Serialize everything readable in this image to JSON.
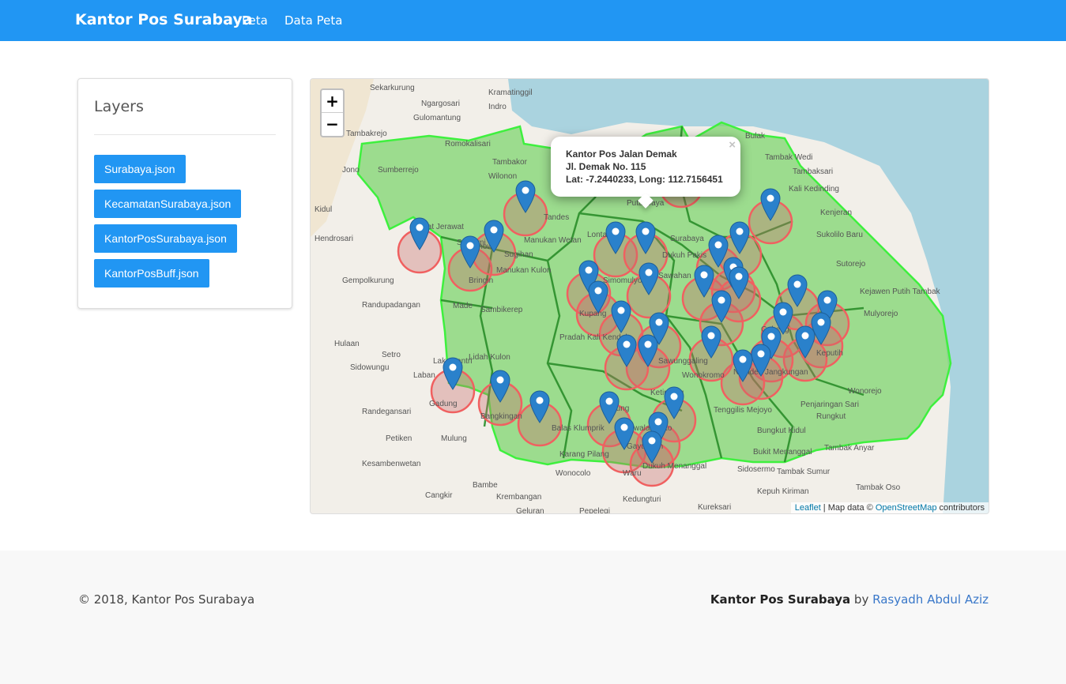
{
  "navbar": {
    "brand": "Kantor Pos Surabaya",
    "links": [
      "Peta",
      "Data Peta"
    ],
    "color": "#2196f3"
  },
  "layers": {
    "title": "Layers",
    "buttons": [
      "Surabaya.json",
      "KecamatanSurabaya.json",
      "KantorPosSurabaya.json",
      "KantorPosBuff.json"
    ]
  },
  "map": {
    "zoom_in": "+",
    "zoom_out": "−",
    "popup": {
      "name": "Kantor Pos Jalan Demak",
      "address": "Jl. Demak No. 115",
      "coords": "Lat: -7.2440233, Long: 112.7156451",
      "close": "×"
    },
    "attribution": {
      "leaflet": "Leaflet",
      "text": " | Map data © ",
      "osm": "OpenStreetMap",
      "suffix": " contributors"
    },
    "place_labels": [
      "Sekarkurung",
      "Kramatinggil",
      "Ngargosari",
      "Indro",
      "Gulomantung",
      "Tambakrejo",
      "Romokalisari",
      "Tambakor",
      "Wilonon",
      "Sumberrejo",
      "Jono",
      "Kidul",
      "Hendrosari",
      "Gempolkurung",
      "Randupadangan",
      "Bringin",
      "Manukan Wetan",
      "Manukan Kulon",
      "Sambikerep",
      "Made",
      "Pradah Kali Kendal",
      "Hulaan",
      "Setro",
      "Sidowungu",
      "Laban",
      "Gadung",
      "Randegansari",
      "Petiken",
      "Mulung",
      "Kesambenwetan",
      "Cangkir",
      "Bambe",
      "Krembangan",
      "Geluran",
      "Pepelegi",
      "Wonocolo",
      "Waru",
      "Kedungturi",
      "Kureksari",
      "Kepuh Kiriman",
      "Tambak Oso",
      "Tambak Sumur",
      "Tambak Anyar",
      "Bukit Menanggal",
      "Bungkut Kidul",
      "Penjaringan Sari",
      "Wonorejo",
      "Kejawen Putih Tambak",
      "Sukolilo Baru",
      "Kenjeran",
      "Bulak",
      "Tambak Wedi",
      "Kali Kedinding",
      "Surabaya",
      "Tandes",
      "Sawahan",
      "Dukuh Pakis",
      "Sutorejo",
      "Keputih",
      "Tenggilis Mejoyo",
      "Nginden Jangkungan",
      "Gayungan",
      "Karang Pilang",
      "Babat Jerawat",
      "Benowo",
      "Sugihan",
      "Simomulyo",
      "Sawunggaling",
      "Wonokromo",
      "Dukuh Menanggal",
      "Sidosermo",
      "Wiyung",
      "Balas Klumprik",
      "Bangkingan",
      "Lakarsantri",
      "Dupak",
      "Tambaksari",
      "Mulyorejo",
      "Gubeng",
      "Rungkut",
      "Siwalankerto",
      "Ketintang",
      "Lidah Kulon",
      "Lontar",
      "Putat Jaya",
      "Kupang",
      "Sememi"
    ]
  }
}
